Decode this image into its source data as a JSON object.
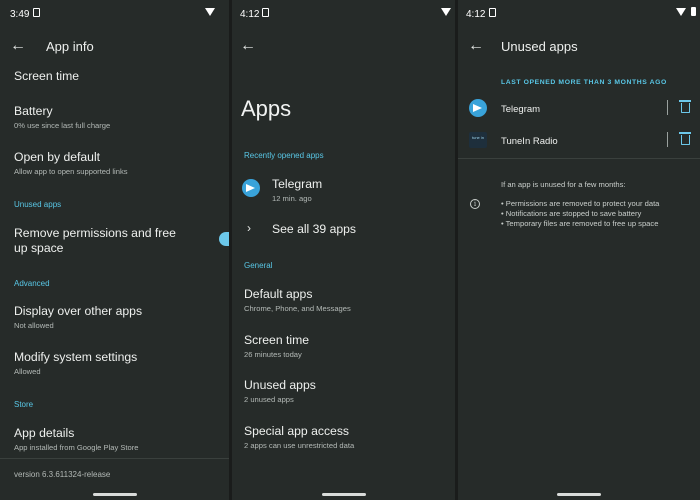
{
  "panel1": {
    "status": {
      "time": "3:49"
    },
    "title": "App info",
    "items": [
      {
        "title": "Screen time",
        "subtitle": ""
      },
      {
        "title": "Battery",
        "subtitle": "0% use since last full charge"
      },
      {
        "title": "Open by default",
        "subtitle": "Allow app to open supported links"
      },
      {
        "title": "Remove permissions and free up space",
        "subtitle": ""
      },
      {
        "title": "Display over other apps",
        "subtitle": "Not allowed"
      },
      {
        "title": "Modify system settings",
        "subtitle": "Allowed"
      },
      {
        "title": "App details",
        "subtitle": "App installed from Google Play Store"
      }
    ],
    "sections": {
      "unused": "Unused apps",
      "advanced": "Advanced",
      "store": "Store"
    },
    "version": "version 6.3.611324-release"
  },
  "panel2": {
    "status": {
      "time": "4:12"
    },
    "title": "Apps",
    "recent_header": "Recently opened apps",
    "recent_app": {
      "name": "Telegram",
      "time": "12 min. ago"
    },
    "see_all": "See all 39 apps",
    "general_header": "General",
    "items": [
      {
        "title": "Default apps",
        "subtitle": "Chrome, Phone, and Messages"
      },
      {
        "title": "Screen time",
        "subtitle": "26 minutes today"
      },
      {
        "title": "Unused apps",
        "subtitle": "2 unused apps"
      },
      {
        "title": "Special app access",
        "subtitle": "2 apps can use unrestricted data"
      }
    ]
  },
  "panel3": {
    "status": {
      "time": "4:12"
    },
    "title": "Unused apps",
    "section_header": "LAST OPENED MORE THAN 3 MONTHS AGO",
    "apps": [
      {
        "name": "Telegram"
      },
      {
        "name": "TuneIn Radio"
      }
    ],
    "tunein_icon_text": "tune in",
    "info": {
      "heading": "If an app is unused for a few months:",
      "bullets": [
        "• Permissions are removed to protect your data",
        "• Notifications are stopped to save battery",
        "• Temporary files are removed to free up space"
      ]
    }
  },
  "colors": {
    "accent": "#59c7e6",
    "background": "#262b29",
    "toggle": "#6cc8ea"
  }
}
